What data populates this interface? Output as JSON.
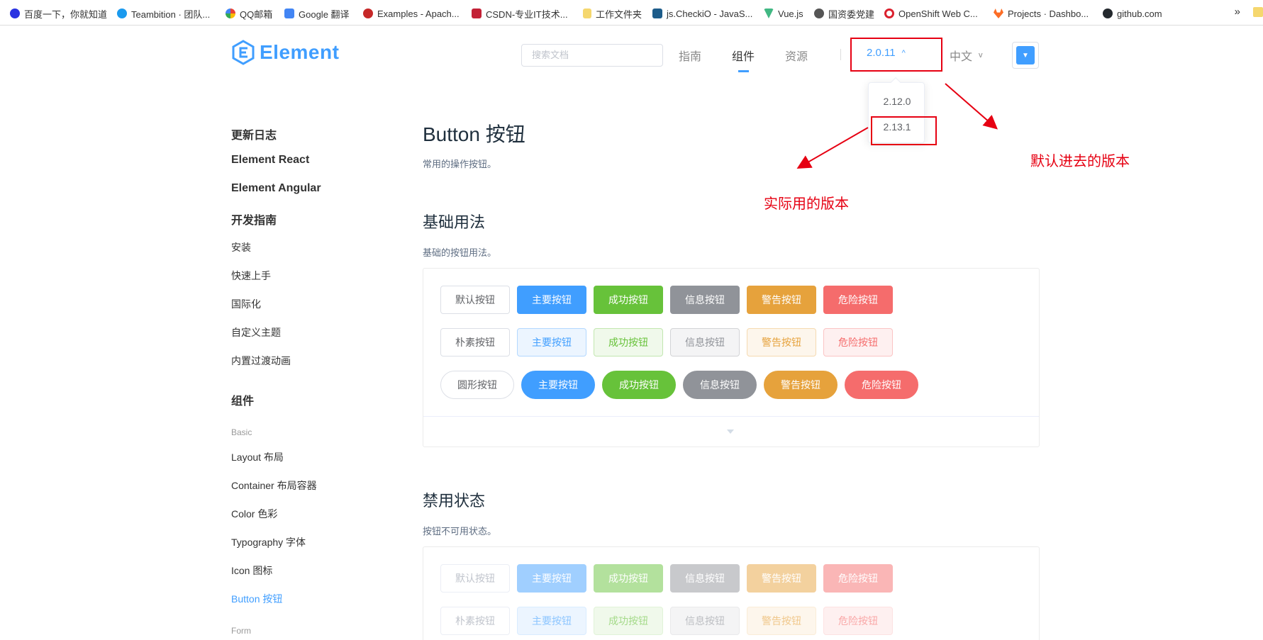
{
  "bookmarks": [
    {
      "label": "百度一下，你就知道",
      "icon": "baidu-icon",
      "color": "#2932e1"
    },
    {
      "label": "Teambition · 团队...",
      "icon": "teambition-icon",
      "color": "#1b9aee"
    },
    {
      "label": "QQ邮箱",
      "icon": "qq-mail-icon",
      "color": "#f5b400"
    },
    {
      "label": "Google 翻译",
      "icon": "google-translate-icon",
      "color": "#4285f4"
    },
    {
      "label": "Examples - Apach...",
      "icon": "apache-icon",
      "color": "#c62828"
    },
    {
      "label": "CSDN-专业IT技术...",
      "icon": "csdn-icon",
      "color": "#c32136"
    },
    {
      "label": "工作文件夹",
      "icon": "folder-icon",
      "color": "#f5d76e"
    },
    {
      "label": "js.CheckiO - JavaS...",
      "icon": "checkio-icon",
      "color": "#1d5c8a"
    },
    {
      "label": "Vue.js",
      "icon": "vue-icon",
      "color": "#41b883"
    },
    {
      "label": "国资委党建",
      "icon": "globe-icon",
      "color": "#555555"
    },
    {
      "label": "OpenShift Web C...",
      "icon": "openshift-icon",
      "color": "#db212e"
    },
    {
      "label": "Projects · Dashbo...",
      "icon": "gitlab-icon",
      "color": "#fc6d26"
    },
    {
      "label": "github.com",
      "icon": "github-icon",
      "color": "#24292e"
    }
  ],
  "bookmarks_more": "»",
  "header": {
    "logo_text": "Element",
    "search_placeholder": "搜索文档",
    "nav": [
      "指南",
      "组件",
      "资源"
    ],
    "active_nav": "组件",
    "version": "2.0.11",
    "version_caret": "^",
    "language": "中文",
    "language_caret": "v"
  },
  "version_dropdown": [
    "2.12.0",
    "2.13.1"
  ],
  "annotations": {
    "default_version": "默认进去的版本",
    "actual_version": "实际用的版本"
  },
  "sidebar": {
    "top_links": [
      "更新日志",
      "Element React",
      "Element Angular",
      "开发指南"
    ],
    "guide_items": [
      "安装",
      "快速上手",
      "国际化",
      "自定义主题",
      "内置过渡动画"
    ],
    "components_heading": "组件",
    "basic_group": "Basic",
    "basic_items": [
      "Layout 布局",
      "Container 布局容器",
      "Color 色彩",
      "Typography 字体",
      "Icon 图标",
      "Button 按钮"
    ],
    "selected_item": "Button 按钮",
    "form_group": "Form"
  },
  "main": {
    "title": "Button 按钮",
    "subtitle": "常用的操作按钮。",
    "basic_title": "基础用法",
    "basic_desc": "基础的按钮用法。",
    "disabled_title": "禁用状态",
    "disabled_desc": "按钮不可用状态。"
  },
  "buttons": {
    "row_default": [
      "默认按钮",
      "主要按钮",
      "成功按钮",
      "信息按钮",
      "警告按钮",
      "危险按钮"
    ],
    "row_plain": [
      "朴素按钮",
      "主要按钮",
      "成功按钮",
      "信息按钮",
      "警告按钮",
      "危险按钮"
    ],
    "row_round": [
      "圆形按钮",
      "主要按钮",
      "成功按钮",
      "信息按钮",
      "警告按钮",
      "危险按钮"
    ],
    "row_disabled": [
      "默认按钮",
      "主要按钮",
      "成功按钮",
      "信息按钮",
      "警告按钮",
      "危险按钮"
    ],
    "row_disabled_plain": [
      "朴素按钮",
      "主要按钮",
      "成功按钮",
      "信息按钮",
      "警告按钮",
      "危险按钮"
    ]
  },
  "colors": {
    "primary": "#409eff",
    "success": "#67c23a",
    "info": "#909399",
    "warning": "#e6a23c",
    "danger": "#f56c6c",
    "annotation_red": "#e60012"
  }
}
